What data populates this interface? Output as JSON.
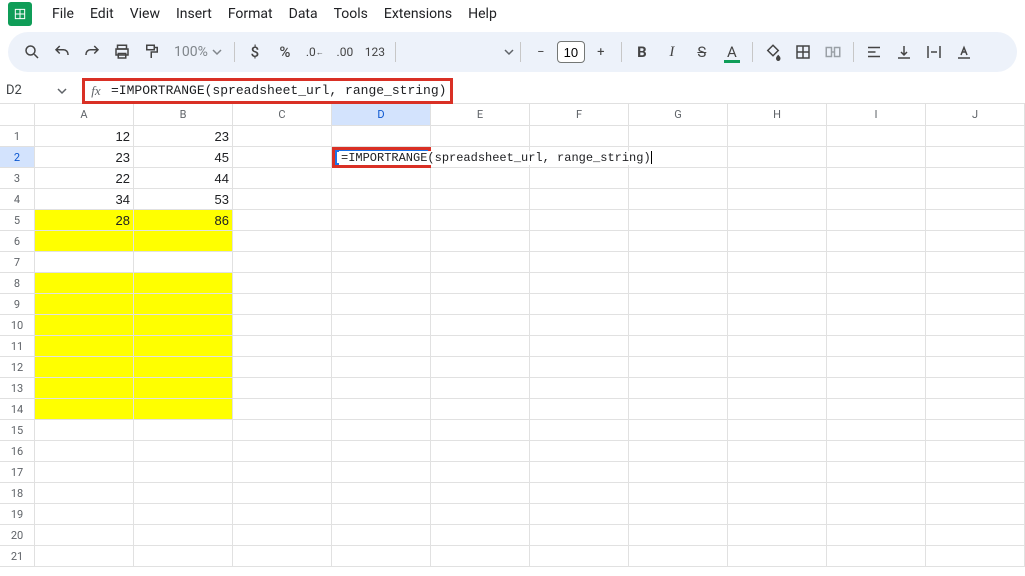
{
  "menu": {
    "items": [
      "File",
      "Edit",
      "View",
      "Insert",
      "Format",
      "Data",
      "Tools",
      "Extensions",
      "Help"
    ]
  },
  "toolbar": {
    "zoom": "100%",
    "font_size": "10"
  },
  "name_box": "D2",
  "formula_bar": "=IMPORTRANGE(spreadsheet_url, range_string)",
  "columns": [
    "A",
    "B",
    "C",
    "D",
    "E",
    "F",
    "G",
    "H",
    "I",
    "J"
  ],
  "selected_col": "D",
  "selected_row": 2,
  "cell_edit": {
    "ref": "D2",
    "text": "=IMPORTRANGE(spreadsheet_url, range_string)"
  },
  "chart_data": null,
  "cells": {
    "A1": {
      "v": "12",
      "align": "num"
    },
    "B1": {
      "v": "23",
      "align": "num"
    },
    "A2": {
      "v": "23",
      "align": "num"
    },
    "B2": {
      "v": "45",
      "align": "num"
    },
    "A3": {
      "v": "22",
      "align": "num"
    },
    "B3": {
      "v": "44",
      "align": "num"
    },
    "A4": {
      "v": "34",
      "align": "num"
    },
    "B4": {
      "v": "53",
      "align": "num"
    },
    "A5": {
      "v": "28",
      "align": "num",
      "bg": "yellow"
    },
    "B5": {
      "v": "86",
      "align": "num",
      "bg": "yellow"
    },
    "A6": {
      "bg": "yellow"
    },
    "B6": {
      "bg": "yellow"
    },
    "A8": {
      "bg": "yellow"
    },
    "B8": {
      "bg": "yellow"
    },
    "A9": {
      "bg": "yellow"
    },
    "B9": {
      "bg": "yellow"
    },
    "A10": {
      "bg": "yellow"
    },
    "B10": {
      "bg": "yellow"
    },
    "A11": {
      "bg": "yellow"
    },
    "B11": {
      "bg": "yellow"
    },
    "A12": {
      "bg": "yellow"
    },
    "B12": {
      "bg": "yellow"
    },
    "A13": {
      "bg": "yellow"
    },
    "B13": {
      "bg": "yellow"
    },
    "A14": {
      "bg": "yellow"
    },
    "B14": {
      "bg": "yellow"
    }
  },
  "row_count": 21
}
